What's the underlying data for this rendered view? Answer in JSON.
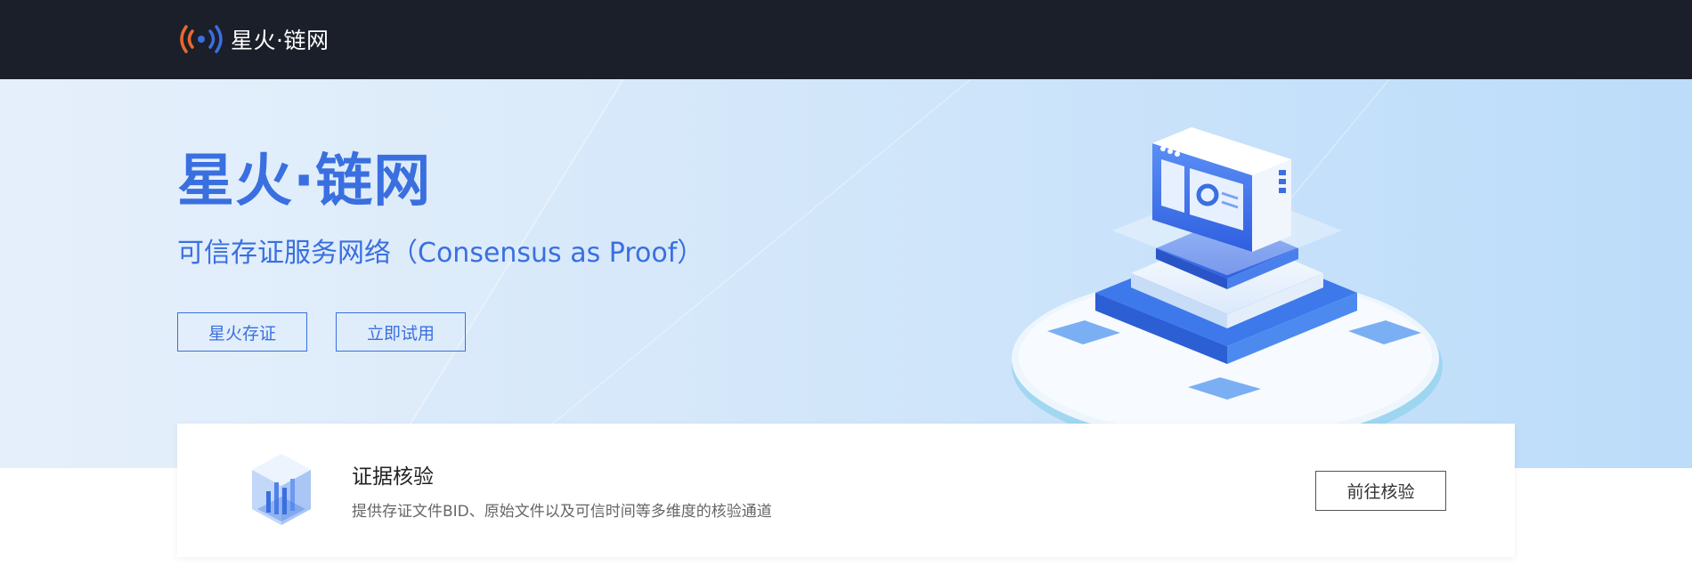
{
  "nav": {
    "logo_icon": "broadcast-signal-icon",
    "logo_text": "星火·链网",
    "logo_colors": {
      "left": "#e8692e",
      "dot": "#3a6fe0",
      "right": "#3a6fe0"
    }
  },
  "hero": {
    "title": "星火·链网",
    "subtitle": "可信存证服务网络（Consensus as Proof）",
    "buttons": [
      {
        "label": "星火存证"
      },
      {
        "label": "立即试用"
      }
    ],
    "illustration": "server-platform-illustration",
    "accent_color": "#3a6fe0"
  },
  "verify_card": {
    "icon": "data-cube-icon",
    "title": "证据核验",
    "description": "提供存证文件BID、原始文件以及可信时间等多维度的核验通道",
    "button_label": "前往核验"
  }
}
